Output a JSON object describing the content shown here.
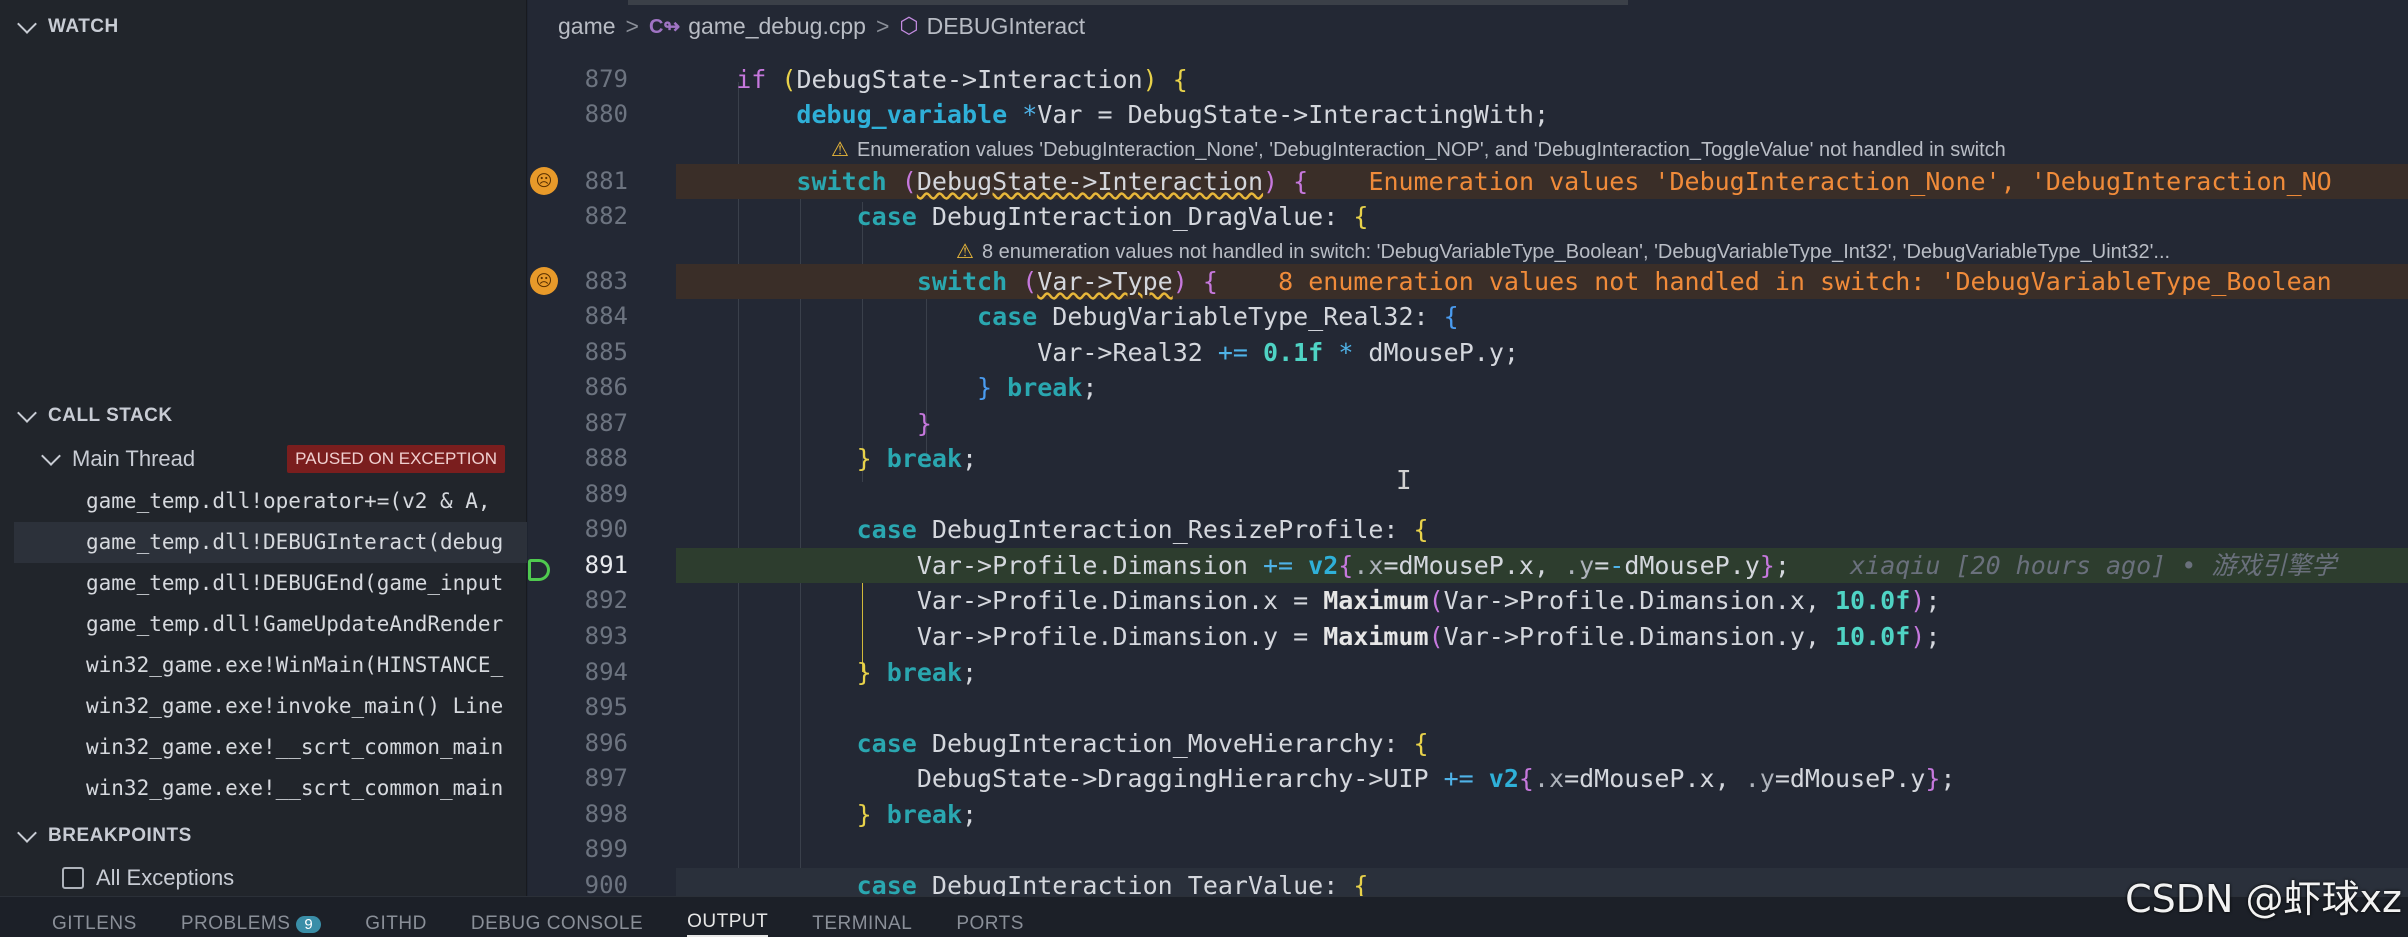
{
  "sidebar": {
    "watch_title": "WATCH",
    "call_stack_title": "CALL STACK",
    "thread_name": "Main Thread",
    "thread_status": "PAUSED ON EXCEPTION",
    "frames": [
      "game_temp.dll!operator+=(v2 & A,",
      "game_temp.dll!DEBUGInteract(debug",
      "game_temp.dll!DEBUGEnd(game_input",
      "game_temp.dll!GameUpdateAndRender",
      "win32_game.exe!WinMain(HINSTANCE_",
      "win32_game.exe!invoke_main() Line",
      "win32_game.exe!__scrt_common_main",
      "win32_game.exe!__scrt_common_main"
    ],
    "breakpoints_title": "BREAKPOINTS",
    "all_exceptions": "All Exceptions"
  },
  "breadcrumb": {
    "folder": "game",
    "file": "game_debug.cpp",
    "symbol": "DEBUGInteract",
    "file_icon": "C++",
    "symbol_icon": "cube"
  },
  "hints": {
    "h1": "Enumeration values 'DebugInteraction_None', 'DebugInteraction_NOP', and 'DebugInteraction_ToggleValue' not handled in switch",
    "h2": "8 enumeration values not handled in switch: 'DebugVariableType_Boolean', 'DebugVariableType_Int32', 'DebugVariableType_Uint32'..."
  },
  "lines": [
    {
      "n": "879"
    },
    {
      "n": "880"
    },
    {
      "n": "881"
    },
    {
      "n": "882"
    },
    {
      "n": "883"
    },
    {
      "n": "884"
    },
    {
      "n": "885"
    },
    {
      "n": "886"
    },
    {
      "n": "887"
    },
    {
      "n": "888"
    },
    {
      "n": "889"
    },
    {
      "n": "890"
    },
    {
      "n": "891"
    },
    {
      "n": "892"
    },
    {
      "n": "893"
    },
    {
      "n": "894"
    },
    {
      "n": "895"
    },
    {
      "n": "896"
    },
    {
      "n": "897"
    },
    {
      "n": "898"
    },
    {
      "n": "899"
    },
    {
      "n": "900"
    }
  ],
  "inline_diagnostics": {
    "d881": "Enumeration values 'DebugInteraction_None', 'DebugInteraction_NO",
    "d883": "8 enumeration values not handled in switch: 'DebugVariableType_Boolean"
  },
  "blame_891": "xiaqiu [20 hours ago] • 游戏引擎学",
  "bottom_tabs": [
    "GITLENS",
    "PROBLEMS",
    "GITHD",
    "DEBUG CONSOLE",
    "OUTPUT",
    "TERMINAL",
    "PORTS"
  ],
  "problems_count": "9",
  "active_tab": "OUTPUT",
  "watermark": "CSDN @虾球xz",
  "colors": {
    "keyword": "#2aa7b0",
    "warning": "#f08b3a",
    "exec": "#4fc94f"
  }
}
